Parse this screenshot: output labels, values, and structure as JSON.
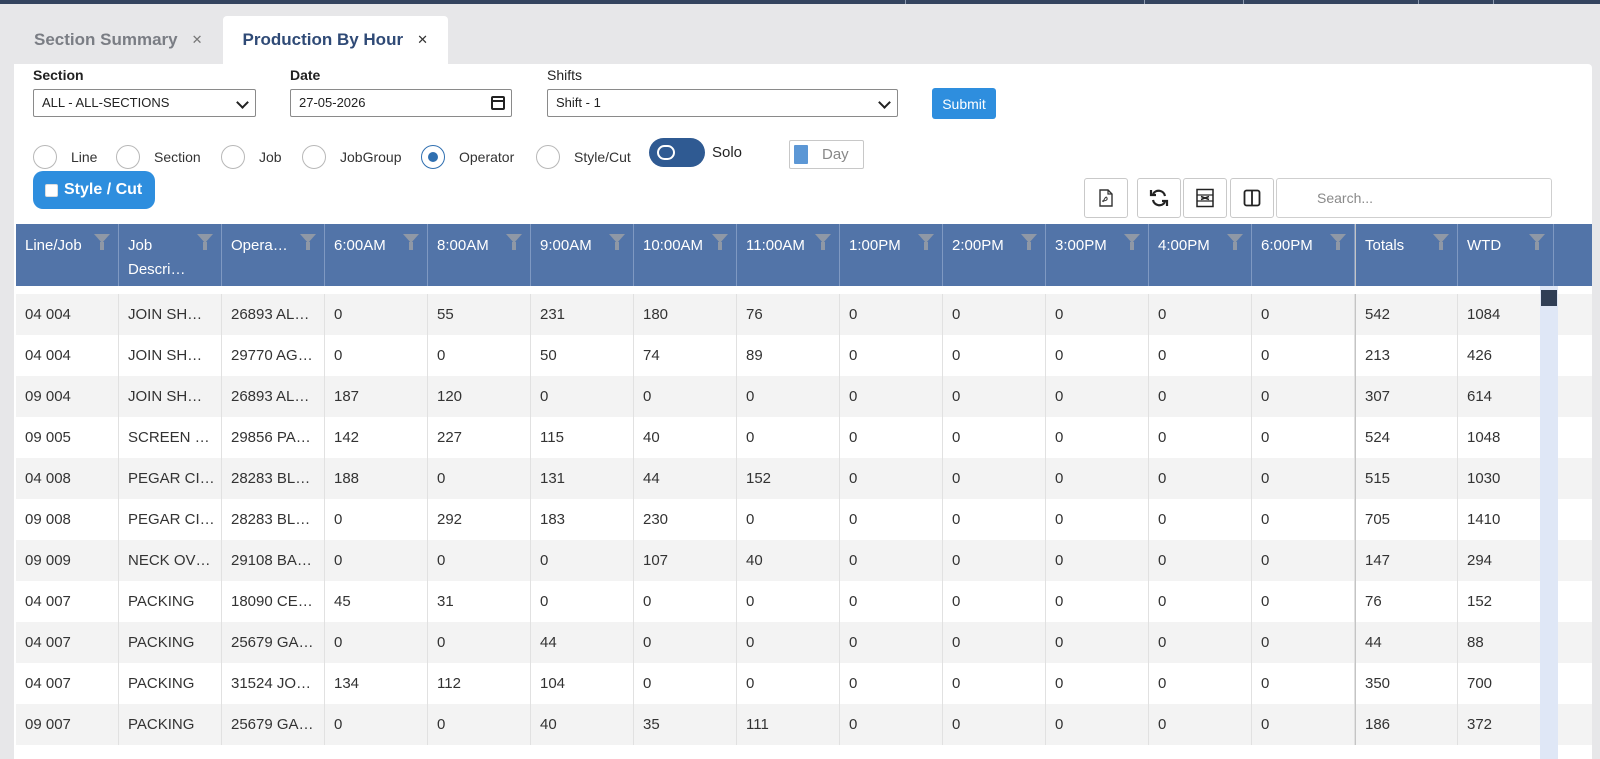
{
  "tabs": [
    {
      "label": "Section Summary",
      "active": false
    },
    {
      "label": "Production By Hour",
      "active": true
    }
  ],
  "filters": {
    "section_label": "Section",
    "section_value": "ALL - ALL-SECTIONS",
    "date_label": "Date",
    "date_value": "27-05-2026",
    "shifts_label": "Shifts",
    "shifts_value": "Shift - 1",
    "submit_label": "Submit"
  },
  "group_by": {
    "options": [
      "Line",
      "Section",
      "Job",
      "JobGroup",
      "Operator",
      "Style/Cut"
    ],
    "selected": "Operator",
    "toggle_label": "Solo",
    "day_label": "Day",
    "style_button_label": "Style / Cut"
  },
  "toolbar": {
    "icons": [
      "pdf-icon",
      "refresh-icon",
      "xlsx-icon",
      "columns-icon"
    ],
    "search_placeholder": "Search..."
  },
  "table": {
    "columns": [
      "Line/Job",
      "Job Descri…",
      "Opera…",
      "6:00AM",
      "8:00AM",
      "9:00AM",
      "10:00AM",
      "11:00AM",
      "1:00PM",
      "2:00PM",
      "3:00PM",
      "4:00PM",
      "6:00PM",
      "Totals",
      "WTD"
    ],
    "rows": [
      [
        "04 004",
        "JOIN SH…",
        "26893 AL…",
        "0",
        "55",
        "231",
        "180",
        "76",
        "0",
        "0",
        "0",
        "0",
        "0",
        "542",
        "1084"
      ],
      [
        "04 004",
        "JOIN SH…",
        "29770 AG…",
        "0",
        "0",
        "50",
        "74",
        "89",
        "0",
        "0",
        "0",
        "0",
        "0",
        "213",
        "426"
      ],
      [
        "09 004",
        "JOIN SH…",
        "26893 AL…",
        "187",
        "120",
        "0",
        "0",
        "0",
        "0",
        "0",
        "0",
        "0",
        "0",
        "307",
        "614"
      ],
      [
        "09 005",
        "SCREEN …",
        "29856 PA…",
        "142",
        "227",
        "115",
        "40",
        "0",
        "0",
        "0",
        "0",
        "0",
        "0",
        "524",
        "1048"
      ],
      [
        "04 008",
        "PEGAR CI…",
        "28283 BL…",
        "188",
        "0",
        "131",
        "44",
        "152",
        "0",
        "0",
        "0",
        "0",
        "0",
        "515",
        "1030"
      ],
      [
        "09 008",
        "PEGAR CI…",
        "28283 BL…",
        "0",
        "292",
        "183",
        "230",
        "0",
        "0",
        "0",
        "0",
        "0",
        "0",
        "705",
        "1410"
      ],
      [
        "09 009",
        "NECK OV…",
        "29108 BA…",
        "0",
        "0",
        "0",
        "107",
        "40",
        "0",
        "0",
        "0",
        "0",
        "0",
        "147",
        "294"
      ],
      [
        "04 007",
        "PACKING",
        "18090 CE…",
        "45",
        "31",
        "0",
        "0",
        "0",
        "0",
        "0",
        "0",
        "0",
        "0",
        "76",
        "152"
      ],
      [
        "04 007",
        "PACKING",
        "25679 GA…",
        "0",
        "0",
        "44",
        "0",
        "0",
        "0",
        "0",
        "0",
        "0",
        "0",
        "44",
        "88"
      ],
      [
        "04 007",
        "PACKING",
        "31524 JO…",
        "134",
        "112",
        "104",
        "0",
        "0",
        "0",
        "0",
        "0",
        "0",
        "0",
        "350",
        "700"
      ],
      [
        "09 007",
        "PACKING",
        "25679 GA…",
        "0",
        "0",
        "40",
        "35",
        "111",
        "0",
        "0",
        "0",
        "0",
        "0",
        "186",
        "372"
      ]
    ]
  }
}
